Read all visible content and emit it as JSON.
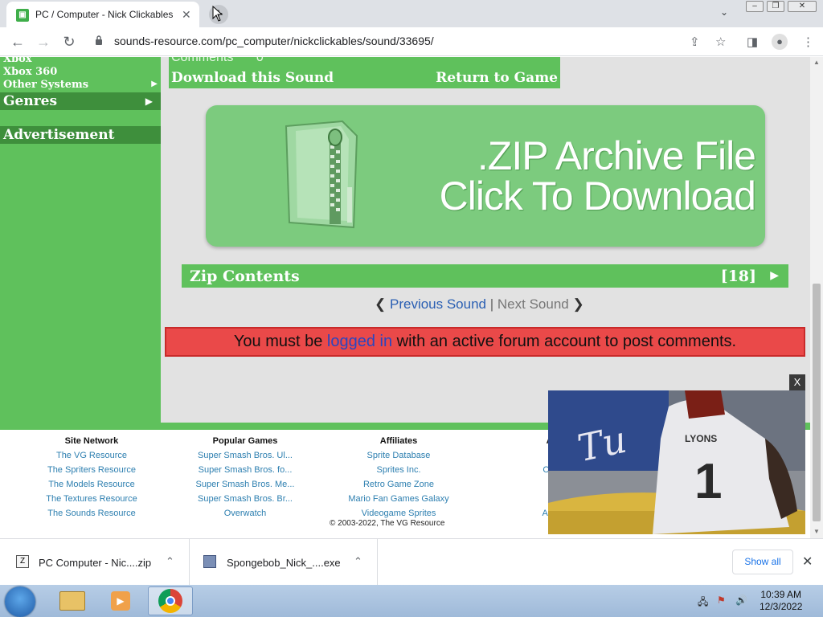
{
  "browser": {
    "tab_title": "PC / Computer - Nick Clickables",
    "url": "sounds-resource.com/pc_computer/nickclickables/sound/33695/"
  },
  "sidebar": {
    "items": [
      "Xbox",
      "Xbox 360",
      "Other Systems"
    ],
    "genres": "Genres",
    "advertisement": "Advertisement"
  },
  "top_section": {
    "comments_label": "Comments",
    "comments_count": "0",
    "download": "Download this Sound",
    "return": "Return to Game"
  },
  "zip_banner": {
    "line1": ".ZIP Archive File",
    "line2": "Click To Download"
  },
  "zip_contents": {
    "label": "Zip Contents",
    "count": "[18]"
  },
  "pager": {
    "prev": "Previous Sound",
    "separator": "|",
    "next": "Next Sound"
  },
  "login_message": {
    "before": "You must be ",
    "link": "logged in",
    "after": " with an active forum account to post comments."
  },
  "footer": {
    "columns": [
      {
        "heading": "Site Network",
        "links": [
          "The VG Resource",
          "The Spriters Resource",
          "The Models Resource",
          "The Textures Resource",
          "The Sounds Resource"
        ]
      },
      {
        "heading": "Popular Games",
        "links": [
          "Super Smash Bros. Ul...",
          "Super Smash Bros. fo...",
          "Super Smash Bros. Me...",
          "Super Smash Bros. Br...",
          "Overwatch"
        ]
      },
      {
        "heading": "Affiliates",
        "links": [
          "Sprite Database",
          "Sprites Inc.",
          "Retro Game Zone",
          "Mario Fan Games Galaxy",
          "Videogame Sprites"
        ]
      },
      {
        "heading": "Ab",
        "links": [
          "A",
          "Cont",
          "S",
          "F",
          "Adve"
        ]
      }
    ],
    "copyright": "© 2003-2022, The VG Resource"
  },
  "video": {
    "close": "X"
  },
  "downloads": {
    "items": [
      {
        "name": "PC Computer - Nic....zip"
      },
      {
        "name": "Spongebob_Nick_....exe"
      }
    ],
    "show_all": "Show all"
  },
  "taskbar": {
    "time": "10:39 AM",
    "date": "12/3/2022"
  },
  "colors": {
    "site_green": "#5fc15c",
    "site_dark_green": "#3e8f3c",
    "alert_red": "#ea4949"
  }
}
